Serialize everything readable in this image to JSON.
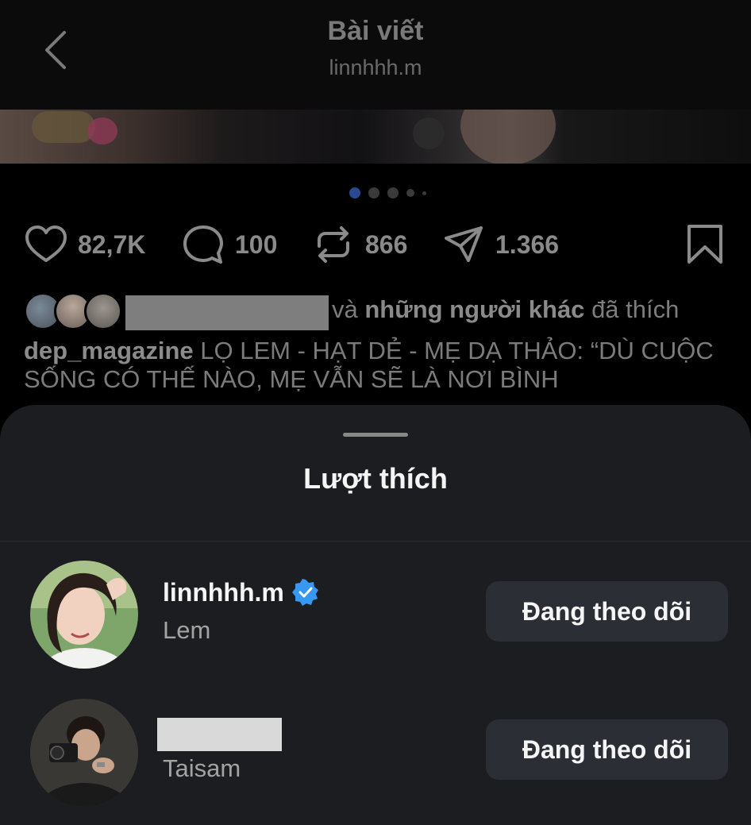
{
  "header": {
    "title": "Bài viết",
    "subtitle": "linnhhh.m"
  },
  "carousel": {
    "total": 5,
    "active_index": 0
  },
  "actions": {
    "likes": "82,7K",
    "comments": "100",
    "reposts": "866",
    "shares": "1.366"
  },
  "liked_by": {
    "connector": "và",
    "others": "những người khác",
    "suffix": "đã thích"
  },
  "caption": {
    "author": "dep_magazine",
    "text": "LỌ LEM - HẠT DẺ - MẸ DẠ THẢO: “DÙ CUỘC SỐNG CÓ THẾ NÀO, MẸ VẪN SẼ LÀ NƠI BÌNH"
  },
  "sheet": {
    "title": "Lượt thích",
    "users": [
      {
        "username": "linnhhh.m",
        "full_name": "Lem",
        "verified": true,
        "button_label": "Đang theo dõi"
      },
      {
        "username": "",
        "full_name": "Taisam",
        "verified": false,
        "button_label": "Đang theo dõi"
      }
    ]
  },
  "colors": {
    "sheet_bg": "#1b1d21",
    "button_bg": "#2b2e34",
    "verified_blue": "#3897f0",
    "carousel_active": "#2a4a8e"
  }
}
